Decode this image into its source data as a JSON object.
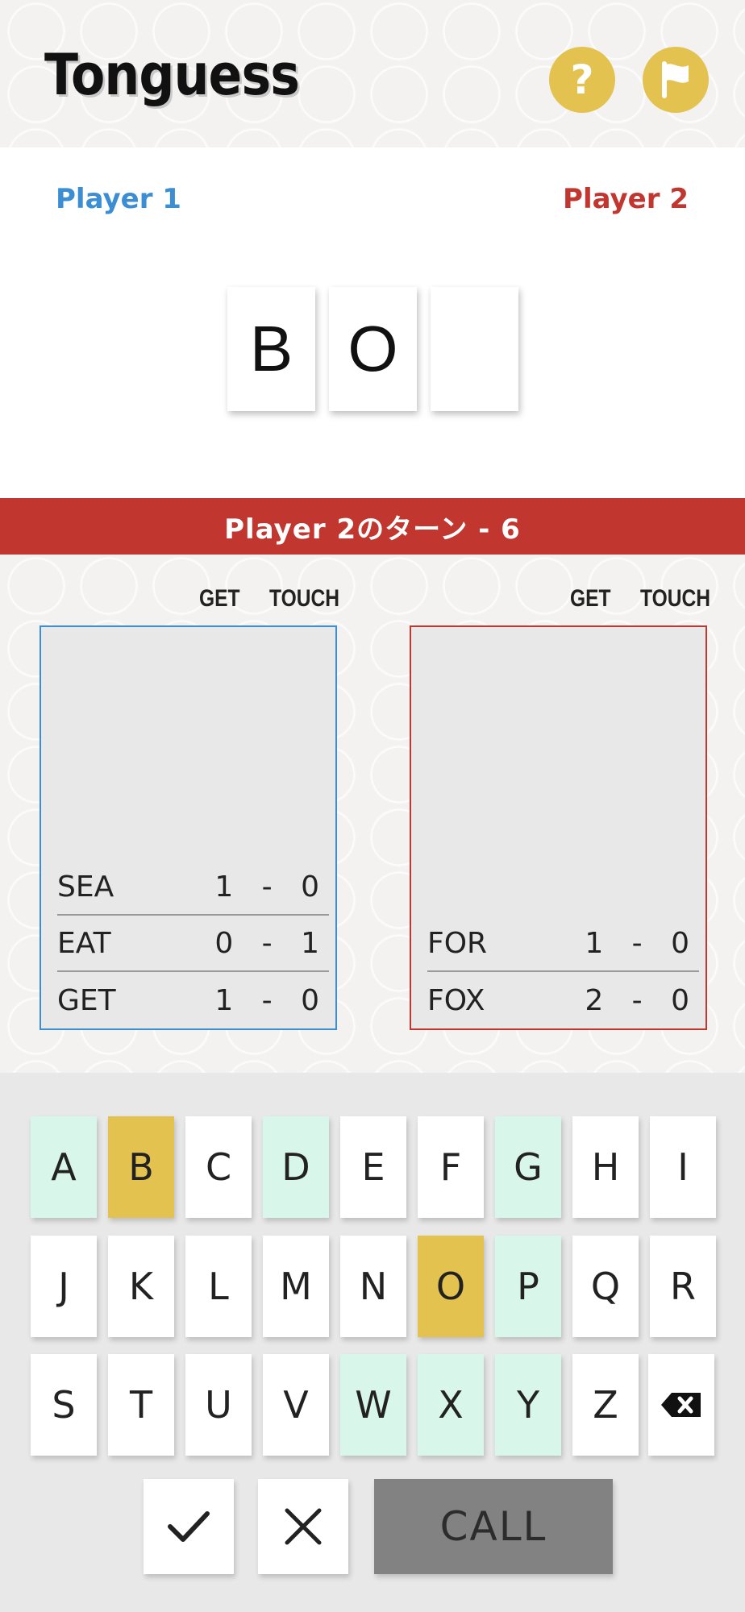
{
  "header": {
    "title": "Tonguess",
    "help_label": "?",
    "colors": {
      "accent": "#e3c24f"
    }
  },
  "players": {
    "player1": "Player 1",
    "player2": "Player 2",
    "colors": {
      "player1": "#3b8dd4",
      "player2": "#c1362f"
    }
  },
  "guess_tiles": [
    "B",
    "O",
    ""
  ],
  "turn_banner": "Player 2のターン - 6",
  "board": {
    "get_label": "GET",
    "touch_label": "TOUCH",
    "player1_words": [
      {
        "word": "SEA",
        "score": "1 - 0"
      },
      {
        "word": "EAT",
        "score": "0 - 1"
      },
      {
        "word": "GET",
        "score": "1 - 0"
      }
    ],
    "player2_words": [
      {
        "word": "FOR",
        "score": "1 - 0"
      },
      {
        "word": "FOX",
        "score": "2 - 0"
      }
    ]
  },
  "keyboard": {
    "rows": [
      [
        {
          "k": "A",
          "s": "hint"
        },
        {
          "k": "B",
          "s": "used"
        },
        {
          "k": "C",
          "s": ""
        },
        {
          "k": "D",
          "s": "hint"
        },
        {
          "k": "E",
          "s": ""
        },
        {
          "k": "F",
          "s": ""
        },
        {
          "k": "G",
          "s": "hint"
        },
        {
          "k": "H",
          "s": ""
        },
        {
          "k": "I",
          "s": ""
        }
      ],
      [
        {
          "k": "J",
          "s": ""
        },
        {
          "k": "K",
          "s": ""
        },
        {
          "k": "L",
          "s": ""
        },
        {
          "k": "M",
          "s": ""
        },
        {
          "k": "N",
          "s": ""
        },
        {
          "k": "O",
          "s": "used"
        },
        {
          "k": "P",
          "s": "hint"
        },
        {
          "k": "Q",
          "s": ""
        },
        {
          "k": "R",
          "s": ""
        }
      ],
      [
        {
          "k": "S",
          "s": ""
        },
        {
          "k": "T",
          "s": ""
        },
        {
          "k": "U",
          "s": ""
        },
        {
          "k": "V",
          "s": ""
        },
        {
          "k": "W",
          "s": "hint"
        },
        {
          "k": "X",
          "s": "hint"
        },
        {
          "k": "Y",
          "s": "hint"
        },
        {
          "k": "Z",
          "s": ""
        }
      ]
    ],
    "call_label": "CALL",
    "icons": [
      "backspace-icon",
      "check-icon",
      "cross-icon",
      "help-icon",
      "flag-icon"
    ],
    "colors": {
      "hint": "#d8f7ea",
      "used": "#e3c24f",
      "call": "#828282"
    }
  }
}
